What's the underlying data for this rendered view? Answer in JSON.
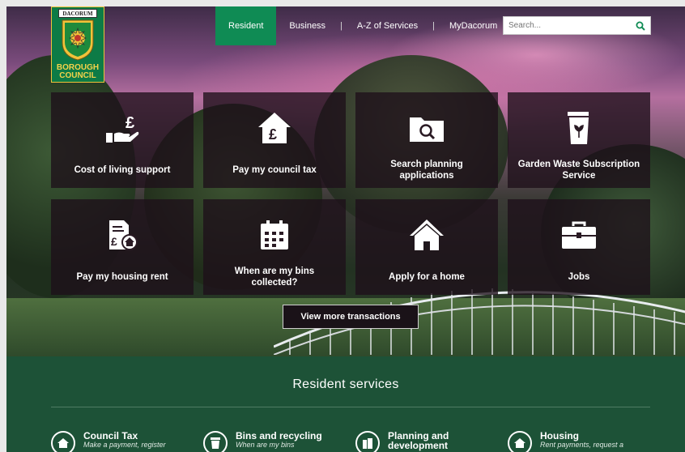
{
  "header": {
    "logo_tag": "DACORUM",
    "logo_line1": "BOROUGH",
    "logo_line2": "COUNCIL",
    "nav": [
      "Resident",
      "Business",
      "A-Z of Services",
      "MyDacorum"
    ],
    "search_placeholder": "Search..."
  },
  "tiles": [
    {
      "label": "Cost of living support",
      "icon": "hand-pound-icon"
    },
    {
      "label": "Pay my council tax",
      "icon": "house-pound-icon"
    },
    {
      "label": "Search planning applications",
      "icon": "folder-search-icon"
    },
    {
      "label": "Garden Waste Subscription Service",
      "icon": "garden-bin-icon"
    },
    {
      "label": "Pay my housing rent",
      "icon": "rent-document-icon"
    },
    {
      "label": "When are my bins collected?",
      "icon": "calendar-icon"
    },
    {
      "label": "Apply for a home",
      "icon": "home-icon"
    },
    {
      "label": "Jobs",
      "icon": "briefcase-icon"
    }
  ],
  "more_button": "View more transactions",
  "services": {
    "title": "Resident services",
    "items": [
      {
        "title": "Council Tax",
        "desc": "Make a payment, register",
        "icon": "house-icon"
      },
      {
        "title": "Bins and recycling",
        "desc": "When are my bins",
        "icon": "bin-icon"
      },
      {
        "title": "Planning and development",
        "desc": "",
        "icon": "planning-icon"
      },
      {
        "title": "Housing",
        "desc": "Rent payments, request a",
        "icon": "housing-icon"
      }
    ]
  },
  "colors": {
    "brand_green": "#0f8b54",
    "services_bg": "#1d5237",
    "tile_bg": "#1e101a",
    "logo_gold": "#f3d24a"
  }
}
